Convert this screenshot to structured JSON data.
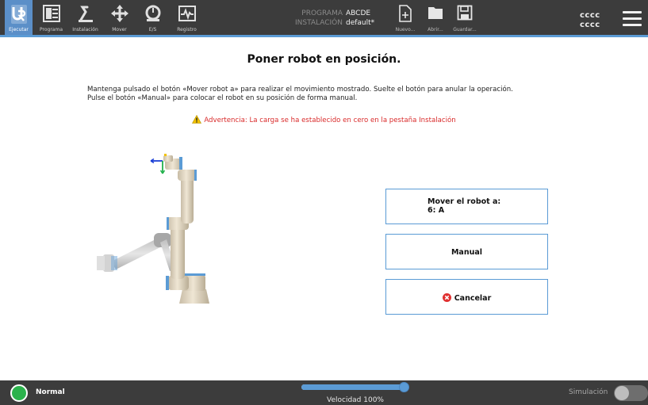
{
  "header": {
    "nav": [
      {
        "label": "Ejecutar",
        "icon": "ur-logo-icon",
        "active": true
      },
      {
        "label": "Programa",
        "icon": "program-icon"
      },
      {
        "label": "Instalación",
        "icon": "installation-icon"
      },
      {
        "label": "Mover",
        "icon": "move-icon"
      },
      {
        "label": "E/S",
        "icon": "io-icon"
      },
      {
        "label": "Registro",
        "icon": "log-icon"
      }
    ],
    "program_key": "PROGRAMA",
    "program_value": "ABCDE",
    "installation_key": "INSTALACIÓN",
    "installation_value": "default*",
    "file_buttons": [
      {
        "label": "Nuevo...",
        "icon": "new-file-icon"
      },
      {
        "label": "Abrir...",
        "icon": "folder-icon"
      },
      {
        "label": "Guardar...",
        "icon": "save-icon"
      }
    ],
    "user_line1": "cccc",
    "user_line2": "cccc",
    "menu_icon": "hamburger-menu-icon"
  },
  "main": {
    "title": "Poner robot en posición.",
    "instruction_line1": "Mantenga pulsado el botón «Mover robot a» para realizar el movimiento mostrado. Suelte el botón para anular la operación.",
    "instruction_line2": "Pulse el botón «Manual» para colocar el robot en su posición de forma manual.",
    "warning": "Advertencia: La carga se ha establecido en cero en la pestaña Instalación",
    "move_button_line1": "Mover el robot a:",
    "move_button_line2": "6: A",
    "manual_button": "Manual",
    "cancel_button": "Cancelar"
  },
  "footer": {
    "status": "Normal",
    "speed_label": "Velocidad 100%",
    "speed_fraction": 1.0,
    "simulation_label": "Simulación",
    "simulation_on": false
  },
  "colors": {
    "header_bg": "#3c3c3c",
    "accent": "#5b9bd5",
    "warning": "#d92a2a",
    "status_ok": "#2bb24c"
  }
}
